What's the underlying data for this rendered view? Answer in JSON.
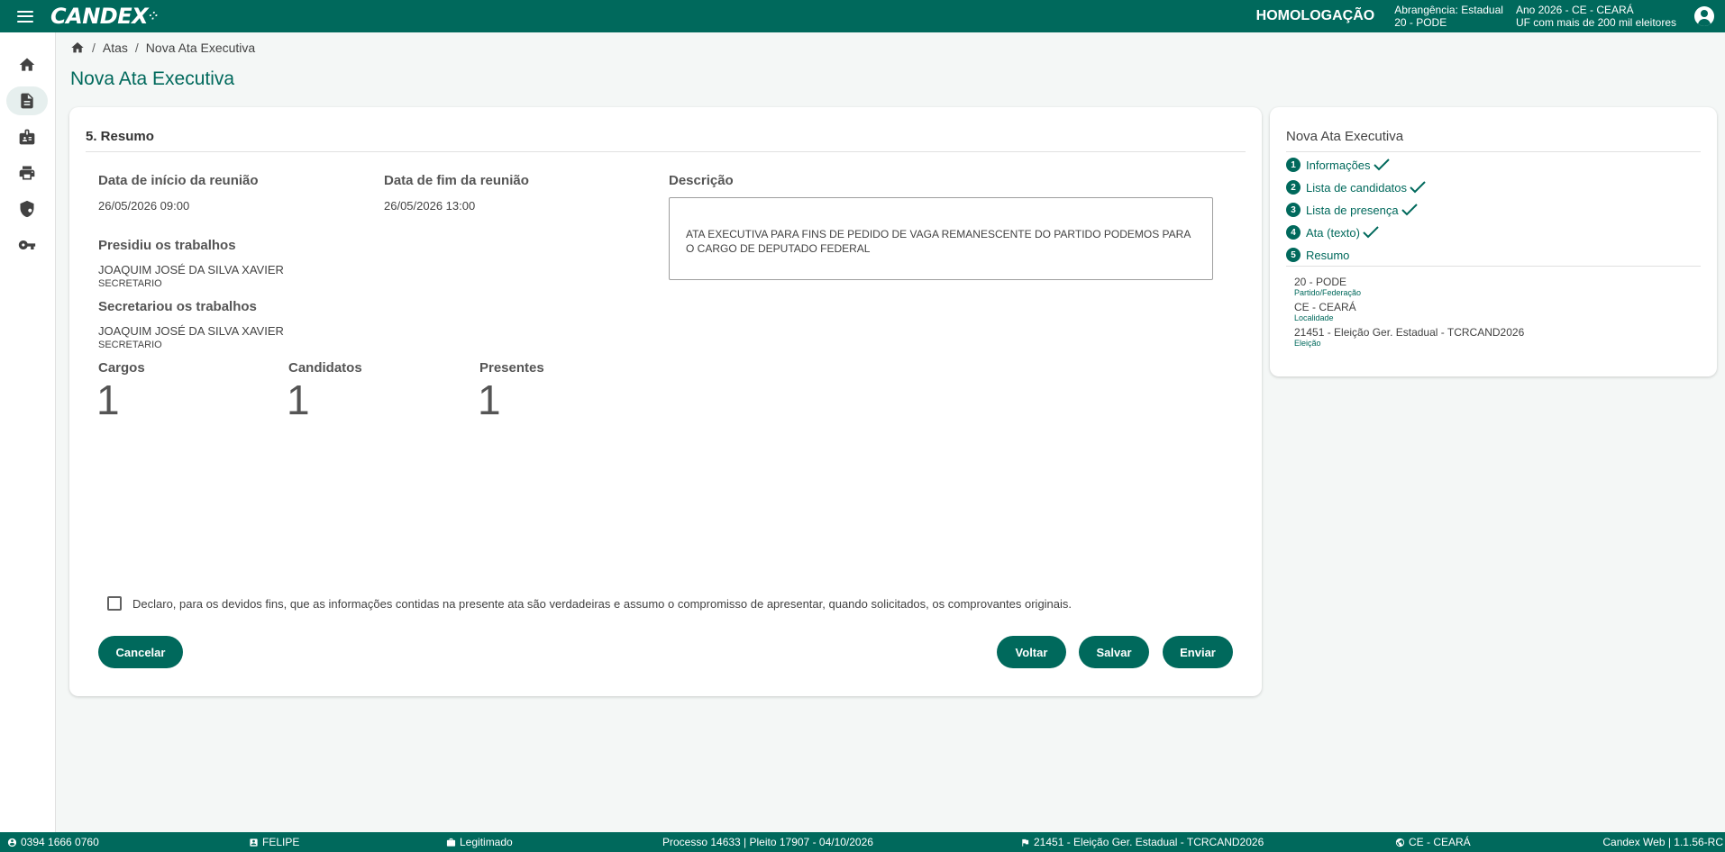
{
  "topbar": {
    "logo": "CANDEX",
    "logo_dots": "⁘",
    "env": "HOMOLOGAÇÃO",
    "abrangencia": "Abrangência: Estadual",
    "partido": "20 - PODE",
    "ano": "Ano 2026 - CE - CEARÁ",
    "uf_info": "UF com mais de 200 mil eleitores"
  },
  "breadcrumb": {
    "items": [
      "Atas",
      "Nova Ata Executiva"
    ],
    "sep": "/"
  },
  "page": {
    "title": "Nova Ata Executiva"
  },
  "resumo": {
    "section_title": "5. Resumo",
    "inicio_label": "Data de início da reunião",
    "inicio_value": "26/05/2026 09:00",
    "fim_label": "Data de fim da reunião",
    "fim_value": "26/05/2026 13:00",
    "descricao_label": "Descrição",
    "descricao_text": "ATA EXECUTIVA PARA FINS DE PEDIDO DE VAGA REMANESCENTE DO PARTIDO PODEMOS PARA O CARGO DE DEPUTADO FEDERAL",
    "presidiu_label": "Presidiu os trabalhos",
    "presidiu_nome": "JOAQUIM JOSÉ DA SILVA XAVIER",
    "presidiu_cargo": "SECRETARIO",
    "secretariou_label": "Secretariou os trabalhos",
    "secretariou_nome": "JOAQUIM JOSÉ DA SILVA XAVIER",
    "secretariou_cargo": "SECRETARIO",
    "stats": [
      {
        "label": "Cargos",
        "value": "1"
      },
      {
        "label": "Candidatos",
        "value": "1"
      },
      {
        "label": "Presentes",
        "value": "1"
      }
    ],
    "declaracao": "Declaro, para os devidos fins, que as informações contidas na presente ata são verdadeiras e assumo o compromisso de apresentar, quando solicitados, os comprovantes originais.",
    "declaracao_checked": false,
    "buttons": {
      "cancelar": "Cancelar",
      "voltar": "Voltar",
      "salvar": "Salvar",
      "enviar": "Enviar"
    }
  },
  "stepper": {
    "title": "Nova Ata Executiva",
    "steps": [
      {
        "num": "1",
        "label": "Informações",
        "done": true
      },
      {
        "num": "2",
        "label": "Lista de candidatos",
        "done": true
      },
      {
        "num": "3",
        "label": "Lista de presença",
        "done": true
      },
      {
        "num": "4",
        "label": "Ata (texto)",
        "done": true
      },
      {
        "num": "5",
        "label": "Resumo",
        "done": false
      }
    ],
    "summary": [
      {
        "value": "20 - PODE",
        "label": "Partido/Federação"
      },
      {
        "value": "CE - CEARÁ",
        "label": "Localidade"
      },
      {
        "value": "21451 - Eleição Ger. Estadual - TCRCAND2026",
        "label": "Eleição"
      }
    ]
  },
  "footer": {
    "phone": "0394 1666 0760",
    "user": "FELIPE",
    "status": "Legitimado",
    "processo": "Processo 14633 | Pleito 17907 - 04/10/2026",
    "eleicao": "21451 - Eleição Ger. Estadual - TCRCAND2026",
    "uf": "CE - CEARÁ",
    "version": "Candex Web | 1.1.56-RC"
  },
  "colors": {
    "primary": "#00695c",
    "background": "#f4f7f6"
  }
}
